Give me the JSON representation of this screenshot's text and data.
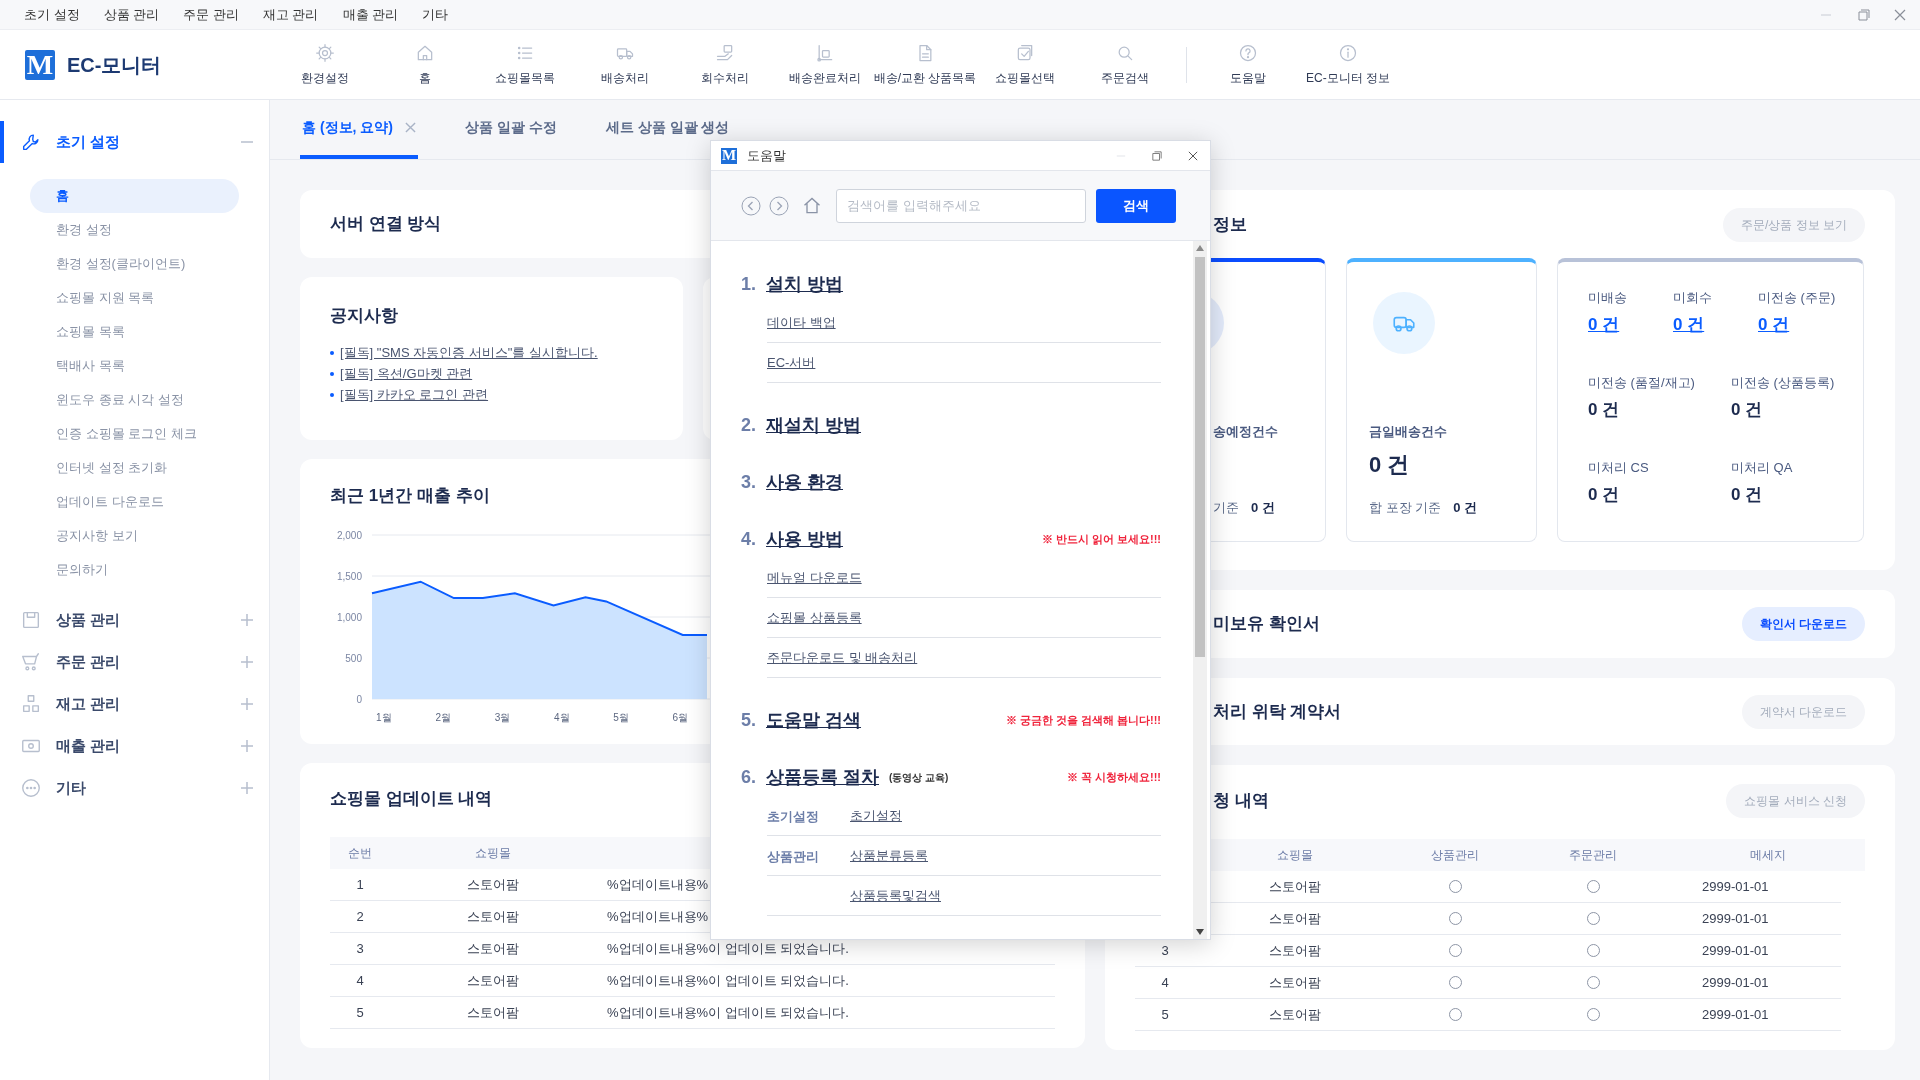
{
  "menu_bar": [
    "초기 설정",
    "상품 관리",
    "주문 관리",
    "재고 관리",
    "매출 관리",
    "기타"
  ],
  "app": {
    "logo_mark": "M",
    "name": "EC-모니터"
  },
  "toolbar": {
    "main": [
      {
        "label": "환경설정"
      },
      {
        "label": "홈"
      },
      {
        "label": "쇼핑몰목록"
      },
      {
        "label": "배송처리"
      },
      {
        "label": "회수처리"
      },
      {
        "label": "배송완료처리"
      },
      {
        "label": "배송/교환 상품목록"
      },
      {
        "label": "쇼핑몰선택"
      },
      {
        "label": "주문검색"
      }
    ],
    "help": [
      {
        "label": "도움말"
      },
      {
        "label": "EC-모니터 정보"
      }
    ]
  },
  "sidebar": {
    "sections": [
      {
        "label": "초기 설정",
        "selected": true,
        "expanded": true,
        "items": [
          {
            "label": "홈",
            "selected": true
          },
          {
            "label": "환경 설정",
            "selected": false
          },
          {
            "label": "환경 설정(클라이언트)",
            "selected": false
          },
          {
            "label": "쇼핑몰 지원 목록",
            "selected": false
          },
          {
            "label": "쇼핑몰 목록",
            "selected": false
          },
          {
            "label": "택배사 목록",
            "selected": false
          },
          {
            "label": "윈도우 종료 시각 설정",
            "selected": false
          },
          {
            "label": "인증 쇼핑몰 로그인 체크",
            "selected": false
          },
          {
            "label": "인터넷 설정 초기화",
            "selected": false
          },
          {
            "label": "업데이트 다운로드",
            "selected": false
          },
          {
            "label": "공지사항 보기",
            "selected": false
          },
          {
            "label": "문의하기",
            "selected": false
          }
        ]
      },
      {
        "label": "상품 관리",
        "selected": false,
        "expanded": false
      },
      {
        "label": "주문 관리",
        "selected": false,
        "expanded": false
      },
      {
        "label": "재고 관리",
        "selected": false,
        "expanded": false
      },
      {
        "label": "매출 관리",
        "selected": false,
        "expanded": false
      },
      {
        "label": "기타",
        "selected": false,
        "expanded": false
      }
    ]
  },
  "tabs": [
    {
      "label": "홈 (정보, 요약)",
      "selected": true,
      "closable": true
    },
    {
      "label": "상품 일괄 수정",
      "selected": false,
      "closable": false
    },
    {
      "label": "세트 상품 일괄 생성",
      "selected": false,
      "closable": false
    }
  ],
  "server_card": {
    "title": "서버 연결 방식"
  },
  "notice_card": {
    "title": "공지사항",
    "links": [
      "[필독] \"SMS 자동인증 서비스\"를 실시합니다.",
      "[필독] 옥션/G마켓 관련",
      "[필독] 카카오 로그인 관련"
    ]
  },
  "sales_chart": {
    "title": "최근 1년간 매출 추이",
    "chart_data": {
      "type": "area",
      "x": [
        0.8,
        1.62,
        2.18,
        2.67,
        3.21,
        3.86,
        4.4,
        4.75,
        6.04,
        6.45
      ],
      "series": [
        {
          "color": "#0a5cff",
          "values": [
            1290,
            1430,
            1230,
            1230,
            1290,
            1140,
            1240,
            1190,
            780,
            780
          ]
        }
      ],
      "xlim": [
        0.8,
        6.5
      ],
      "ylim": [
        0,
        2000
      ],
      "grid": true,
      "yticks": [
        {
          "value": 0,
          "label": "0"
        },
        {
          "value": 500,
          "label": "500"
        },
        {
          "value": 1000,
          "label": "1,000"
        },
        {
          "value": 1500,
          "label": "1,500"
        },
        {
          "value": 2000,
          "label": "2,000"
        }
      ],
      "xticks": [
        {
          "value": 1,
          "label": "1월"
        },
        {
          "value": 2,
          "label": "2월"
        },
        {
          "value": 3,
          "label": "3월"
        },
        {
          "value": 4,
          "label": "4월"
        },
        {
          "value": 5,
          "label": "5월"
        },
        {
          "value": 6,
          "label": "6월"
        }
      ]
    }
  },
  "update_table": {
    "title": "쇼핑몰 업데이트 내역",
    "columns": [
      "순번",
      "쇼핑몰"
    ],
    "rows": [
      {
        "cells": [
          "1",
          "스토어팜",
          "%업데이트내용%"
        ]
      },
      {
        "cells": [
          "2",
          "스토어팜",
          "%업데이트내용%"
        ]
      },
      {
        "cells": [
          "3",
          "스토어팜",
          "%업데이트내용%이 업데이트 되었습니다."
        ]
      },
      {
        "cells": [
          "4",
          "스토어팜",
          "%업데이트내용%이 업데이트 되었습니다."
        ]
      },
      {
        "cells": [
          "5",
          "스토어팜",
          "%업데이트내용%이 업데이트 되었습니다."
        ]
      }
    ]
  },
  "info_card": {
    "title": "정보",
    "button": {
      "label": "주문/상품 정보 보기",
      "disabled": true
    },
    "stat_cards": [
      {
        "kind": "count",
        "color": "#0a4cff",
        "label": "송예정건수",
        "footer_label": "기준",
        "footer_value": "0 건"
      },
      {
        "kind": "count",
        "color": "#4db1ff",
        "label": "금일배송건수",
        "value": "0 건",
        "footer_label": "합 포장 기준",
        "footer_value": "0 건"
      },
      {
        "kind": "grid",
        "color": "#b8c2d8",
        "stats": [
          {
            "label": "미배송",
            "value": "0 건",
            "kind": "link"
          },
          {
            "label": "미회수",
            "value": "0 건",
            "kind": "link"
          },
          {
            "label": "미전송 (주문)",
            "value": "0 건",
            "kind": "link"
          },
          {
            "label": "미전송 (품절/재고)",
            "value": "0 건",
            "kind": "count"
          },
          {
            "label": "미전송 (상품등록)",
            "value": "0 건",
            "kind": "count"
          },
          {
            "label": "미처리 CS",
            "value": "0 건",
            "kind": "count"
          },
          {
            "label": "미처리 QA",
            "value": "0 건",
            "kind": "count"
          }
        ]
      }
    ]
  },
  "certificate_card": {
    "title": "미보유 확인서",
    "button": {
      "label": "확인서 다운로드",
      "disabled": false
    }
  },
  "contract_card": {
    "title": "처리 위탁 계약서",
    "button": {
      "label": "계약서 다운로드",
      "disabled": true
    }
  },
  "service_table": {
    "title": "청 내역",
    "button": {
      "label": "쇼핑몰 서비스 신청",
      "disabled": true
    },
    "columns": [
      "쇼핑몰",
      "상품관리",
      "주문관리",
      "메세지"
    ],
    "rows": [
      {
        "mall": "스토어팜",
        "product": false,
        "order": false,
        "message": "2999-01-01"
      },
      {
        "mall": "스토어팜",
        "product": false,
        "order": false,
        "message": "2999-01-01"
      },
      {
        "no": "3",
        "mall": "스토어팜",
        "product": false,
        "order": false,
        "message": "2999-01-01"
      },
      {
        "no": "4",
        "mall": "스토어팜",
        "product": false,
        "order": false,
        "message": "2999-01-01"
      },
      {
        "no": "5",
        "mall": "스토어팜",
        "product": false,
        "order": false,
        "message": "2999-01-01"
      }
    ]
  },
  "help_dialog": {
    "logo_mark": "M",
    "title": "도움말",
    "search": {
      "placeholder": "검색어를 입력해주세요"
    },
    "search_button": "검색",
    "sections": [
      {
        "number": "1.",
        "title": "설치 방법",
        "items": [
          "데이타 백업",
          "EC-서버"
        ]
      },
      {
        "number": "2.",
        "title": "재설치 방법"
      },
      {
        "number": "3.",
        "title": "사용 환경"
      },
      {
        "number": "4.",
        "title": "사용 방법",
        "note": "※ 반드시 읽어 보세요!!!",
        "items": [
          "메뉴얼 다운로드",
          "쇼핑몰 상품등록",
          "주문다운로드 및 배송처리"
        ]
      },
      {
        "number": "5.",
        "title": "도움말 검색",
        "note": "※ 궁금한 것을 검색해 봅니다!!!"
      },
      {
        "number": "6.",
        "title": "상품등록 절차",
        "subtitle": "(동영상 교육)",
        "note": "※ 꼭 시청하세요!!!",
        "rows": [
          {
            "category": "초기설정",
            "link": "초기설정"
          },
          {
            "category": "상품관리",
            "link": "상품분류등록"
          },
          {
            "link": "상품등록및검색"
          }
        ]
      }
    ]
  }
}
